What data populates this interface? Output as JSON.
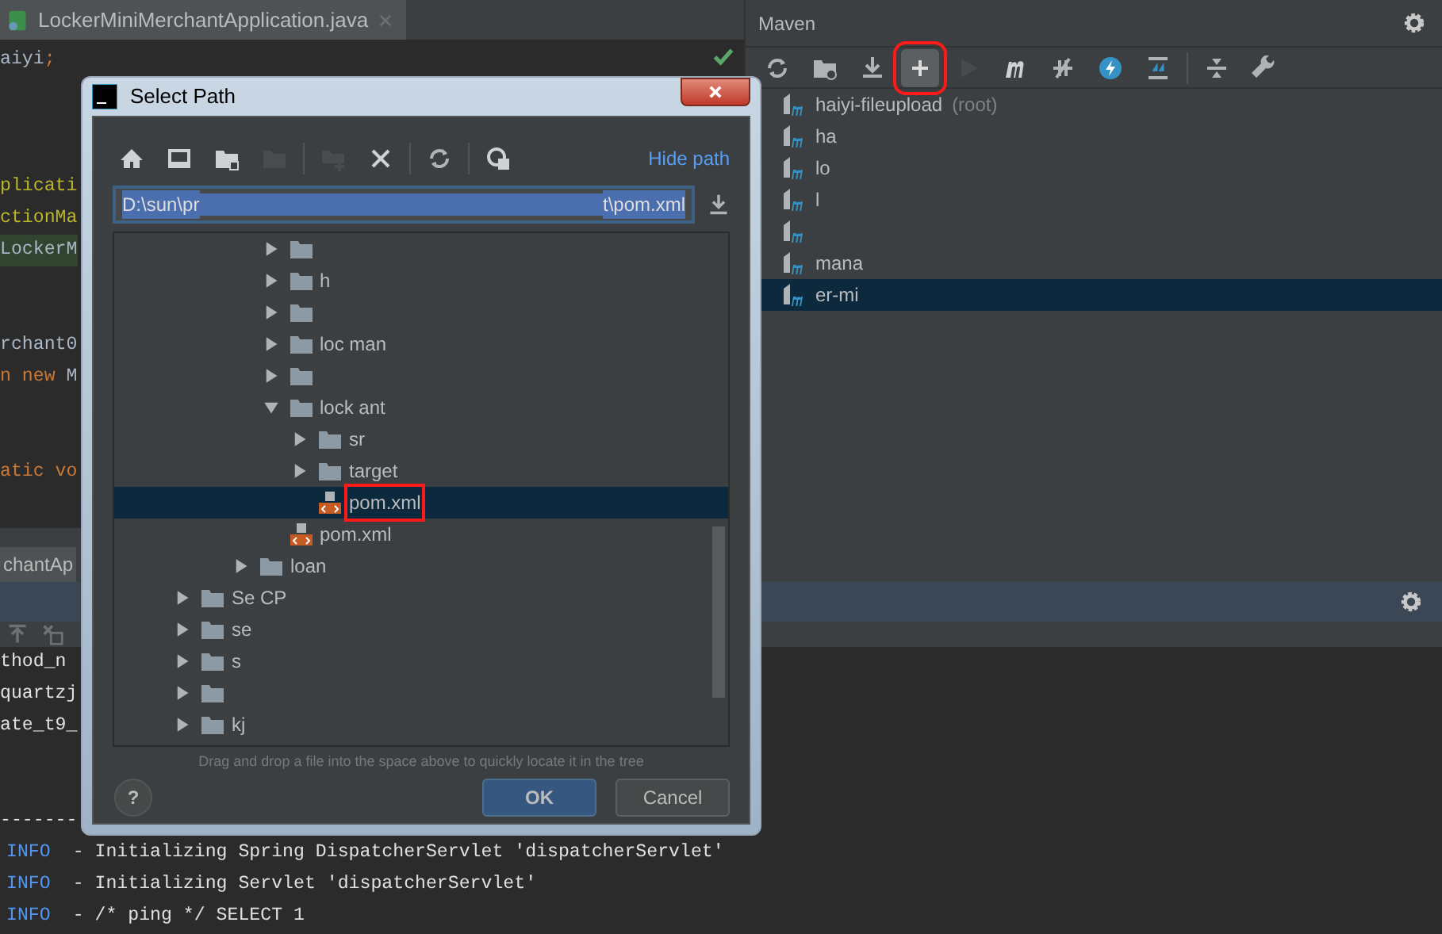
{
  "editor": {
    "tab": {
      "title": "LockerMiniMerchantApplication.java"
    },
    "lines": [
      {
        "highlighted": false,
        "segments": [
          {
            "text": "aiyi",
            "kind": "plain"
          },
          {
            "text": ";",
            "kind": "keyword"
          }
        ]
      },
      {
        "highlighted": false
      },
      {
        "highlighted": false
      },
      {
        "highlighted": false
      },
      {
        "highlighted": false,
        "segments": [
          {
            "text": "plicati",
            "kind": "annotation"
          }
        ]
      },
      {
        "highlighted": false,
        "segments": [
          {
            "text": "ctionMa",
            "kind": "annotation"
          }
        ]
      },
      {
        "highlighted": true,
        "segments": [
          {
            "text": "LockerM",
            "kind": "plain"
          }
        ]
      },
      {
        "highlighted": false
      },
      {
        "highlighted": false
      },
      {
        "highlighted": false,
        "segments": [
          {
            "text": "rchant0",
            "kind": "plain"
          }
        ]
      },
      {
        "highlighted": false,
        "segments": [
          {
            "text": "n new ",
            "kind": "keyword"
          },
          {
            "text": "M",
            "kind": "plain"
          }
        ]
      },
      {
        "highlighted": false
      },
      {
        "highlighted": false
      },
      {
        "highlighted": false,
        "segments": [
          {
            "text": "atic vo",
            "kind": "keyword"
          }
        ]
      }
    ]
  },
  "maven": {
    "title": "Maven",
    "toolbar": [
      {
        "kind": "refresh",
        "disabled": false,
        "marked": false
      },
      {
        "kind": "folder-sync",
        "disabled": false,
        "marked": false
      },
      {
        "kind": "download",
        "disabled": false,
        "marked": false
      },
      {
        "kind": "plus",
        "disabled": false,
        "marked": true
      },
      {
        "kind": "run",
        "disabled": true,
        "marked": false
      },
      {
        "kind": "m",
        "disabled": false,
        "marked": false
      },
      {
        "kind": "skip",
        "disabled": false,
        "marked": false
      },
      {
        "kind": "bolt",
        "disabled": false,
        "marked": false
      },
      {
        "kind": "expand",
        "disabled": false,
        "marked": false
      },
      {
        "kind": "collapse",
        "disabled": false,
        "marked": false
      },
      {
        "kind": "wrench",
        "disabled": false,
        "marked": false
      }
    ],
    "projects": [
      {
        "label": "haiyi-fileupload",
        "suffix": "(root)",
        "selected": false
      },
      {
        "label": "ha",
        "selected": false
      },
      {
        "label": "lo",
        "selected": false
      },
      {
        "label": "l",
        "selected": false
      },
      {
        "selected": false
      },
      {
        "label": "mana",
        "selected": false
      },
      {
        "label": "er-mi",
        "selected": true
      }
    ]
  },
  "run_panel": {
    "tab": "chantAp",
    "console": [
      {
        "kind": "output",
        "text": "thod_n"
      },
      {
        "kind": "output",
        "text": "quartzj"
      },
      {
        "kind": "output",
        "text": "ate_t9_"
      },
      {
        "kind": "separator",
        "text": "-------"
      },
      {
        "kind": "log",
        "level": "INFO",
        "text": "- Initializing Spring DispatcherServlet 'dispatcherServlet'"
      },
      {
        "kind": "log",
        "level": "INFO",
        "text": "- Initializing Servlet 'dispatcherServlet'"
      },
      {
        "kind": "log",
        "level": "INFO",
        "text": "- /* ping */ SELECT 1"
      }
    ]
  },
  "dialog": {
    "title": "Select Path",
    "toolbar": [
      {
        "kind": "home",
        "disabled": false
      },
      {
        "kind": "desktop",
        "disabled": false
      },
      {
        "kind": "folder-module",
        "disabled": false
      },
      {
        "kind": "folder",
        "disabled": true
      },
      {
        "kind": "new-folder",
        "disabled": true
      },
      {
        "kind": "delete",
        "disabled": false
      },
      {
        "kind": "refresh",
        "disabled": false
      },
      {
        "kind": "hidden",
        "disabled": false
      }
    ],
    "hide_path_link": "Hide path",
    "path_field": {
      "value_start": "D:\\sun\\pr",
      "value_end": "t\\pom.xml"
    },
    "tree": [
      {
        "children": [
          {
            "children": [
              {
                "children": [
                  {
                    "kind": "folder",
                    "expanded": false,
                    "selected": false,
                    "marked": false
                  },
                  {
                    "kind": "folder",
                    "label": "h",
                    "expanded": false,
                    "selected": false,
                    "marked": false
                  },
                  {
                    "kind": "folder",
                    "expanded": false,
                    "selected": false,
                    "marked": false
                  },
                  {
                    "kind": "folder",
                    "label": "loc man",
                    "expanded": false,
                    "selected": false,
                    "marked": false
                  },
                  {
                    "kind": "folder",
                    "expanded": false,
                    "selected": false,
                    "marked": false
                  },
                  {
                    "kind": "folder",
                    "label": "lock ant",
                    "expanded": true,
                    "selected": false,
                    "marked": false,
                    "children": [
                      {
                        "kind": "folder",
                        "label": "sr",
                        "expanded": false,
                        "selected": false,
                        "marked": false
                      },
                      {
                        "kind": "folder",
                        "label": "target",
                        "expanded": false,
                        "selected": false,
                        "marked": false
                      },
                      {
                        "kind": "file",
                        "label": "pom.xml",
                        "selected": true,
                        "marked": true
                      }
                    ]
                  },
                  {
                    "kind": "file",
                    "label": "pom.xml",
                    "selected": false,
                    "marked": false
                  }
                ]
              },
              {
                "kind": "folder",
                "label": "loan",
                "expanded": false,
                "selected": false,
                "marked": false
              }
            ]
          }
        ]
      },
      {
        "kind": "folder",
        "label": "Se CP",
        "expanded": false,
        "selected": false,
        "marked": false
      },
      {
        "kind": "folder",
        "label": "se",
        "expanded": false,
        "selected": false,
        "marked": false
      },
      {
        "kind": "folder",
        "label": "s",
        "expanded": false,
        "selected": false,
        "marked": false
      },
      {
        "kind": "folder",
        "expanded": false,
        "selected": false,
        "marked": false
      },
      {
        "kind": "folder",
        "label": "kj",
        "expanded": false,
        "selected": false,
        "marked": false
      }
    ],
    "hint": "Drag and drop a file into the space above to quickly locate it in the tree",
    "help": "?",
    "buttons": [
      {
        "label": "OK",
        "default": true
      },
      {
        "label": "Cancel",
        "default": false
      }
    ]
  }
}
